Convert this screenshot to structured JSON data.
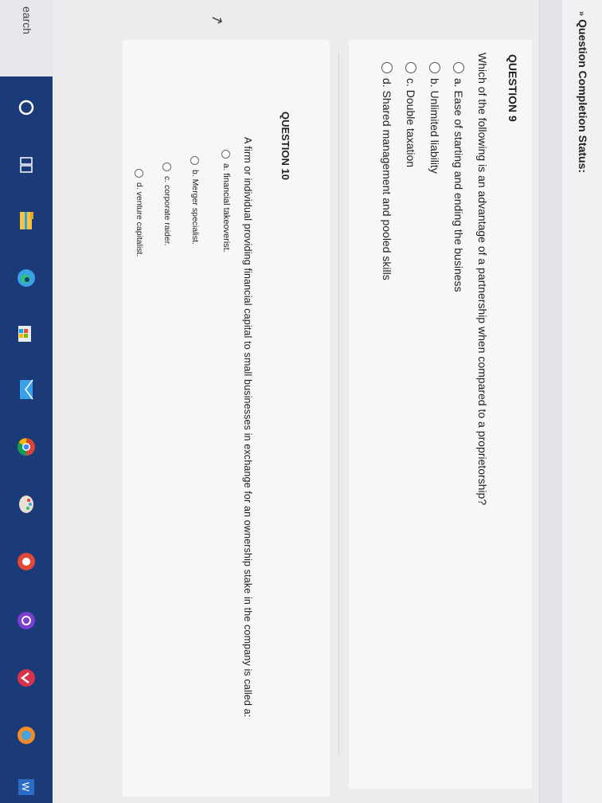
{
  "header": {
    "chevron": "»",
    "status_label": "Question Completion Status:"
  },
  "question9": {
    "title": "QUESTION 9",
    "text": "Which of the following is an advantage of a partnership when compared to a proprietorship?",
    "options": [
      "a. Ease of starting and ending the business",
      "b. Unlimited liability",
      "c. Double taxation",
      "d. Shared management and pooled skills"
    ]
  },
  "question10": {
    "title": "QUESTION 10",
    "text": "A firm or individual providing financial capital to small businesses in exchange for an ownership stake in the company is called a:",
    "options": [
      "a. financial takeoverist.",
      "b. Merger specialist.",
      "c. corporate raider.",
      "d. venture capitalist."
    ]
  },
  "taskbar": {
    "search_label": "earch",
    "icons": [
      "cortana-icon",
      "task-view-icon",
      "file-explorer-icon",
      "edge-icon",
      "store-icon",
      "mail-icon",
      "chrome-icon",
      "paint-icon",
      "record-icon",
      "media-icon",
      "vpn-icon",
      "app-icon",
      "word-icon"
    ],
    "colors": {
      "bar": "#1b3a78",
      "accent": "#3aa0e8"
    }
  }
}
